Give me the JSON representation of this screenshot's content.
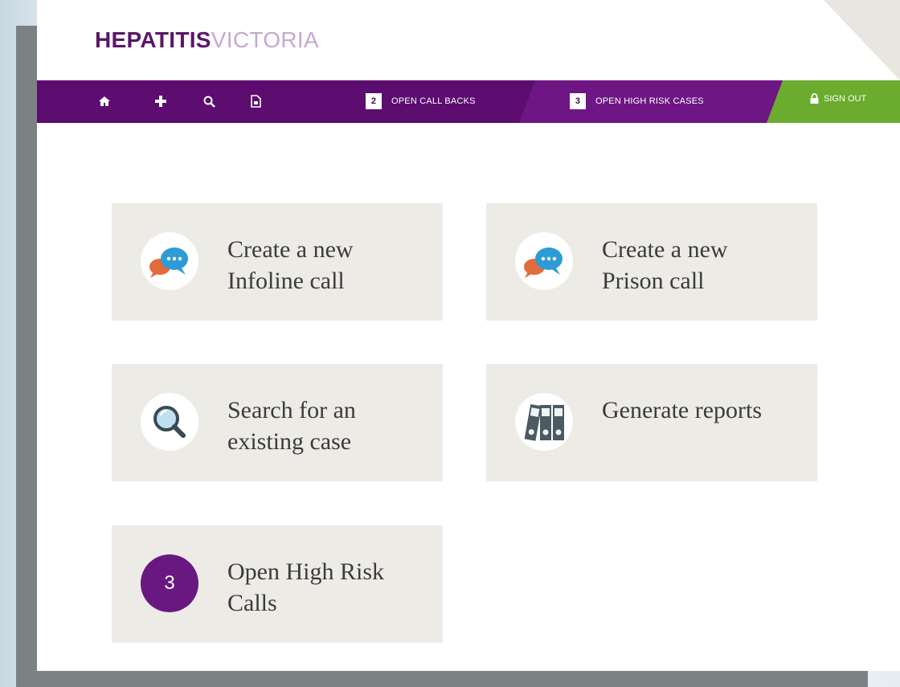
{
  "brand": {
    "part1": "HEPATITIS",
    "part2": "VICTORIA"
  },
  "nav": {
    "icons": [
      "home-icon",
      "plus-icon",
      "search-icon",
      "document-icon"
    ],
    "call_backs": {
      "count": "2",
      "label": "OPEN CALL BACKS"
    },
    "high_risk": {
      "count": "3",
      "label": "OPEN HIGH RISK CASES"
    },
    "sign_out": "SIGN OUT"
  },
  "tiles": [
    {
      "label": "Create a new Infoline call",
      "icon": "chat-bubbles-icon"
    },
    {
      "label": "Create a new Prison call",
      "icon": "chat-bubbles-icon"
    },
    {
      "label": "Search for an existing case",
      "icon": "magnifier-icon"
    },
    {
      "label": "Generate reports",
      "icon": "binders-icon"
    },
    {
      "label": "Open High Risk Calls",
      "badge": "3"
    }
  ],
  "colors": {
    "purple_dark": "#5c0d6f",
    "purple_mid": "#6e1684",
    "green": "#6bab2e",
    "tile_bg": "#edebe6"
  }
}
